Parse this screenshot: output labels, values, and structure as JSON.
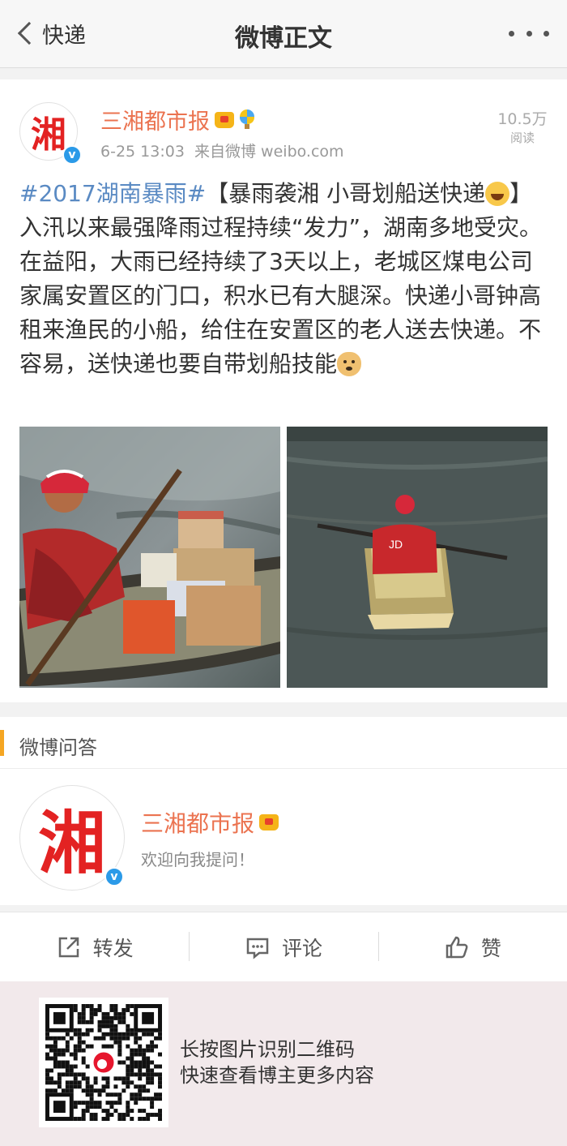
{
  "nav": {
    "back_label": "快递",
    "title": "微博正文"
  },
  "post": {
    "author": "三湘都市报",
    "avatar_glyph": "湘",
    "timestamp": "6-25 13:03",
    "source": "来自微博 weibo.com",
    "reads_count": "10.5万",
    "reads_label": "阅读",
    "hashtag": "#2017湖南暴雨#",
    "text_part1": "【暴雨袭湘  小哥划船送快递",
    "text_part2": "】入汛以来最强降雨过程持续“发力”，湖南多地受灾。在益阳，大雨已经持续了3天以上，老城区煤电公司家属安置区的门口，积水已有大腿深。快递小哥钟高租来渔民的小船，给住在安置区的老人送去快递。不容易，送快递也要自带划船技能",
    "emoji1": "laughing-crying-emoji",
    "emoji2": "doge-emoji",
    "accent_color": "#eb7350",
    "hashtag_color": "#5a8ac3"
  },
  "qa": {
    "section_title": "微博问答",
    "author": "三湘都市报",
    "avatar_glyph": "湘",
    "subtitle": "欢迎向我提问！",
    "accent_bar_color": "#f5a623"
  },
  "actions": {
    "repost": "转发",
    "comment": "评论",
    "like": "赞"
  },
  "qr": {
    "line1": "长按图片识别二维码",
    "line2": "快速查看博主更多内容"
  }
}
